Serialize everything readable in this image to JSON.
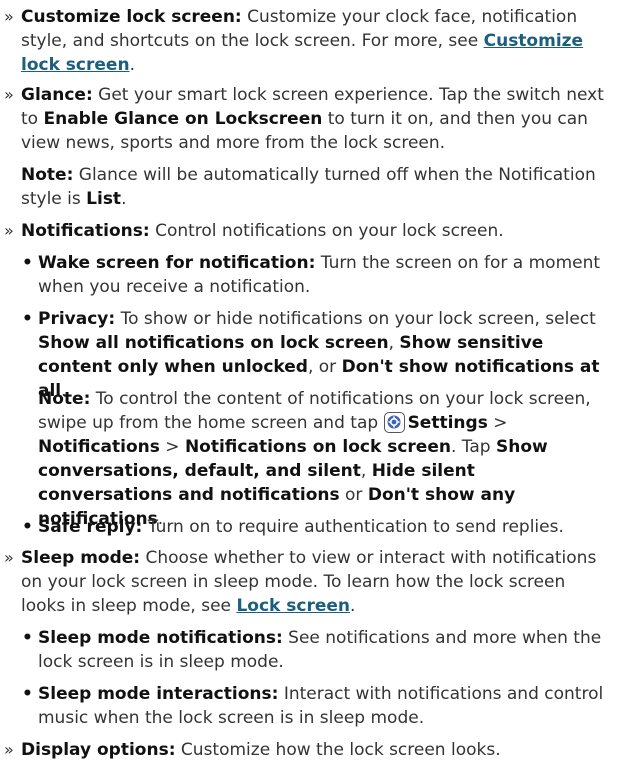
{
  "items": {
    "customize": {
      "title": "Customize lock screen:",
      "text": "Customize your clock face, notification style, and shortcuts on the lock screen. For more, see",
      "link": "Customize lock screen"
    },
    "glance": {
      "title": "Glance:",
      "text_a": "Get your smart lock screen experience. Tap the switch next to",
      "bold_a": "Enable Glance on Lockscreen",
      "text_b": "to turn it on, and then you can view news, sports and more from the lock screen.",
      "note_label": "Note:",
      "note_text": "Glance will be automatically turned off when the Notification style is",
      "note_bold": "List"
    },
    "notifications": {
      "title": "Notifications:",
      "text": "Control notifications on your lock screen.",
      "wake_title": "Wake screen for notification:",
      "wake_text": "Turn the screen on for a moment when you receive a notification.",
      "privacy_title": "Privacy:",
      "privacy_text": "To show or hide notifications on your lock screen, select",
      "privacy_opt1": "Show all notifications on lock screen",
      "privacy_opt2": "Show sensitive content only when unlocked",
      "privacy_or": ", or",
      "privacy_opt3": "Don't show notifications at all",
      "note_label": "Note:",
      "note_text": "To control the content of notifications on your lock screen, swipe up from the home screen and tap",
      "settings": "Settings",
      "notifications_bold": "Notifications",
      "notif_on_lock": "Notifications on lock screen",
      "tap": ". Tap",
      "opt_a": "Show conversations, default, and silent",
      "opt_b": "Hide silent conversations and notifications",
      "or": "or",
      "opt_c": "Don't show any notifications",
      "safe_title": "Safe reply:",
      "safe_text": "Turn on to require authentication to send replies."
    },
    "sleep": {
      "title": "Sleep mode:",
      "text": "Choose whether to view or interact with notifications on your lock screen in sleep mode. To learn how the lock screen looks in sleep mode, see",
      "link": "Lock screen",
      "notif_title": "Sleep mode notifications:",
      "notif_text": "See notifications and more when the lock screen is in sleep mode.",
      "inter_title": "Sleep mode interactions:",
      "inter_text": "Interact with notifications and control music when the lock screen is in sleep mode."
    },
    "display": {
      "title": "Display options:",
      "text": "Customize how the lock screen looks."
    }
  },
  "icons": {
    "settings": "gear-icon"
  },
  "colors": {
    "link": "#1a5e80",
    "text": "#333333"
  }
}
